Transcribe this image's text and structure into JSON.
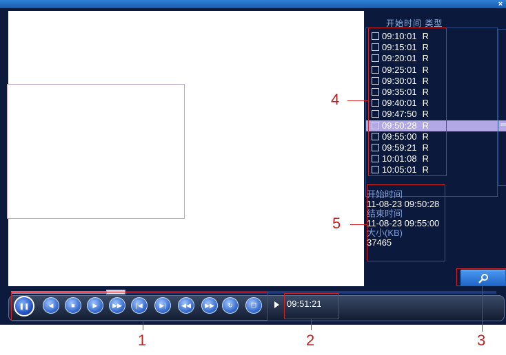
{
  "window": {
    "close_glyph": "×"
  },
  "recording_list": {
    "header": "开始时间 类型",
    "items": [
      {
        "time": "09:10:01",
        "type": "R",
        "selected": false
      },
      {
        "time": "09:15:01",
        "type": "R",
        "selected": false
      },
      {
        "time": "09:20:01",
        "type": "R",
        "selected": false
      },
      {
        "time": "09:25:01",
        "type": "R",
        "selected": false
      },
      {
        "time": "09:30:01",
        "type": "R",
        "selected": false
      },
      {
        "time": "09:35:01",
        "type": "R",
        "selected": false
      },
      {
        "time": "09:40:01",
        "type": "R",
        "selected": false
      },
      {
        "time": "09:47:50",
        "type": "R",
        "selected": false
      },
      {
        "time": "09:50:28",
        "type": "R",
        "selected": true
      },
      {
        "time": "09:55:00",
        "type": "R",
        "selected": false
      },
      {
        "time": "09:59:21",
        "type": "R",
        "selected": false
      },
      {
        "time": "10:01:08",
        "type": "R",
        "selected": false
      },
      {
        "time": "10:05:01",
        "type": "R",
        "selected": false
      }
    ]
  },
  "file_info": {
    "start_label": "开始时间",
    "start_value": "11-08-23 09:50:28",
    "end_label": "结束时间",
    "end_value": "11-08-23 09:55:00",
    "size_label": "大小(KB)",
    "size_value": "37465"
  },
  "playback": {
    "current_time": "09:51:21",
    "progress_fraction": 0.23,
    "controls": [
      {
        "name": "pause-icon",
        "glyph": "❚❚"
      },
      {
        "name": "rewind-icon",
        "glyph": "◀"
      },
      {
        "name": "stop-icon",
        "glyph": "■"
      },
      {
        "name": "slow-play-icon",
        "glyph": "▶"
      },
      {
        "name": "fast-forward-icon",
        "glyph": "▶▶"
      },
      {
        "name": "previous-frame-icon",
        "glyph": "|◀"
      },
      {
        "name": "next-frame-icon",
        "glyph": "▶|"
      },
      {
        "name": "previous-file-icon",
        "glyph": "◀◀"
      },
      {
        "name": "next-file-icon",
        "glyph": "▶▶"
      },
      {
        "name": "loop-icon",
        "glyph": "↻"
      },
      {
        "name": "fullscreen-icon",
        "glyph": "❐"
      }
    ]
  },
  "search": {
    "icon": "search-icon"
  },
  "callouts": [
    "1",
    "2",
    "3",
    "4",
    "5"
  ],
  "colors": {
    "panel_bg": "#0b1a3c",
    "selected_row": "#b3a8e6",
    "callout_red": "#d32020",
    "button_blue": "#2d62c8"
  }
}
